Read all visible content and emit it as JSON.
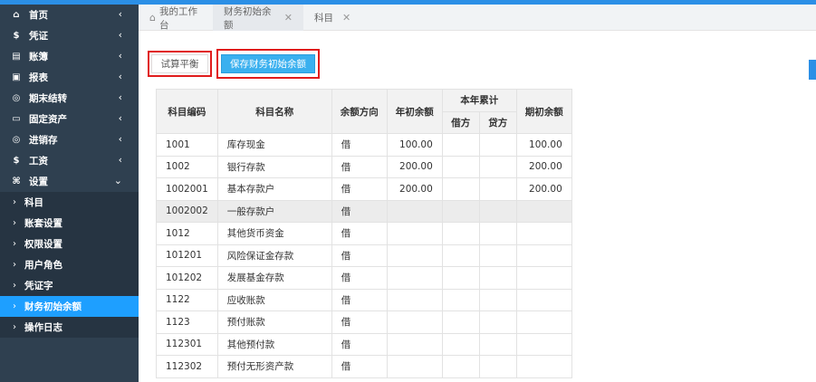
{
  "sidebar": {
    "items": [
      {
        "label": "首页",
        "icon": "home-icon"
      },
      {
        "label": "凭证",
        "icon": "dollar-icon"
      },
      {
        "label": "账簿",
        "icon": "book-icon"
      },
      {
        "label": "报表",
        "icon": "report-icon"
      },
      {
        "label": "期末结转",
        "icon": "cycle-icon"
      },
      {
        "label": "固定资产",
        "icon": "monitor-icon"
      },
      {
        "label": "进销存",
        "icon": "inventory-icon"
      },
      {
        "label": "工资",
        "icon": "dollar-icon"
      },
      {
        "label": "设置",
        "icon": "settings-icon"
      }
    ],
    "sub_items": [
      "科目",
      "账套设置",
      "权限设置",
      "用户角色",
      "凭证字",
      "财务初始余额",
      "操作日志"
    ]
  },
  "tabs": [
    {
      "label": "我的工作台"
    },
    {
      "label": "财务初始余额"
    },
    {
      "label": "科目"
    }
  ],
  "toolbar": {
    "trial_label": "试算平衡",
    "save_label": "保存财务初始余额"
  },
  "table": {
    "headers": {
      "code": "科目编码",
      "name": "科目名称",
      "direction": "余额方向",
      "opening": "年初余额",
      "ytd": "本年累计",
      "debit": "借方",
      "credit": "贷方",
      "period": "期初余额"
    },
    "rows": [
      {
        "code": "1001",
        "name": "库存现金",
        "dir": "借",
        "opening": "100.00",
        "debit": "",
        "credit": "",
        "period": "100.00"
      },
      {
        "code": "1002",
        "name": "银行存款",
        "dir": "借",
        "opening": "200.00",
        "debit": "",
        "credit": "",
        "period": "200.00"
      },
      {
        "code": "1002001",
        "name": "基本存款户",
        "dir": "借",
        "opening": "200.00",
        "debit": "",
        "credit": "",
        "period": "200.00"
      },
      {
        "code": "1002002",
        "name": "一般存款户",
        "dir": "借",
        "opening": "",
        "debit": "",
        "credit": "",
        "period": ""
      },
      {
        "code": "1012",
        "name": "其他货币资金",
        "dir": "借",
        "opening": "",
        "debit": "",
        "credit": "",
        "period": ""
      },
      {
        "code": "101201",
        "name": "风险保证金存款",
        "dir": "借",
        "opening": "",
        "debit": "",
        "credit": "",
        "period": ""
      },
      {
        "code": "101202",
        "name": "发展基金存款",
        "dir": "借",
        "opening": "",
        "debit": "",
        "credit": "",
        "period": ""
      },
      {
        "code": "1122",
        "name": "应收账款",
        "dir": "借",
        "opening": "",
        "debit": "",
        "credit": "",
        "period": ""
      },
      {
        "code": "1123",
        "name": "预付账款",
        "dir": "借",
        "opening": "",
        "debit": "",
        "credit": "",
        "period": ""
      },
      {
        "code": "112301",
        "name": "其他预付款",
        "dir": "借",
        "opening": "",
        "debit": "",
        "credit": "",
        "period": ""
      },
      {
        "code": "112302",
        "name": "预付无形资产款",
        "dir": "借",
        "opening": "",
        "debit": "",
        "credit": "",
        "period": ""
      }
    ]
  },
  "colors": {
    "sidebar_bg": "#2f4050",
    "accent": "#1e9fff",
    "highlight_border": "#e01c1c"
  }
}
